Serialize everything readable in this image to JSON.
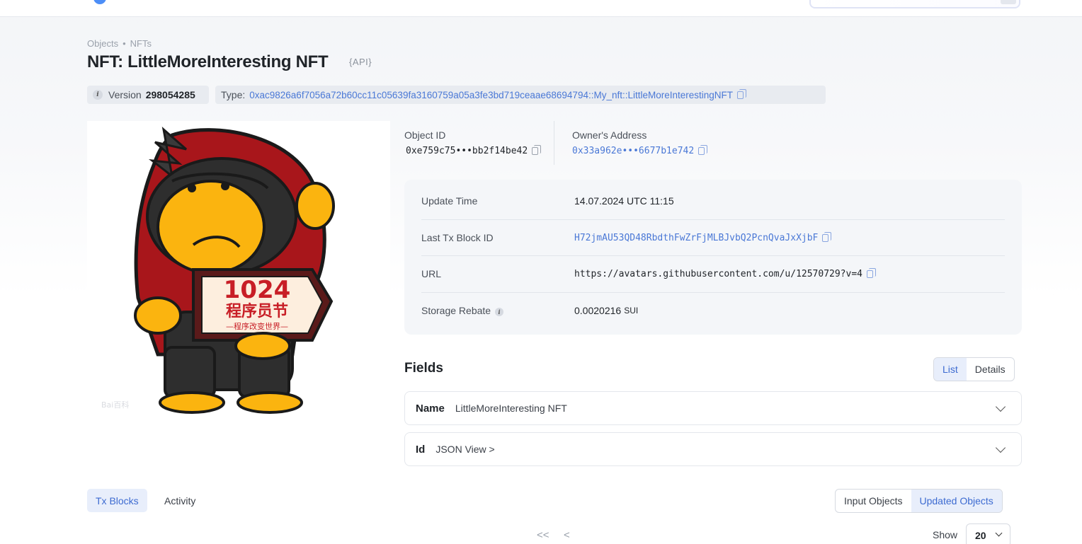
{
  "breadcrumb": {
    "items": [
      "Objects",
      "NFTs"
    ],
    "separator": "•"
  },
  "title": "NFT: LittleMoreInteresting NFT",
  "api_label": "{API}",
  "version": {
    "label": "Version",
    "value": "298054285"
  },
  "type": {
    "label": "Type:",
    "value": "0xac9826a6f7056a72b60cc11c05639fa3160759a05a3fe3bd719ceaae68694794::My_nft::LittleMoreInterestingNFT"
  },
  "object_id": {
    "label": "Object ID",
    "value": "0xe759c75•••bb2f14be42"
  },
  "owner": {
    "label": "Owner's Address",
    "value": "0x33a962e•••6677b1e742"
  },
  "properties": [
    {
      "label": "Update Time",
      "value": "14.07.2024 UTC 11:15"
    },
    {
      "label": "Last Tx Block ID",
      "value": "H72jmAU53QD48RbdthFwZrFjMLBJvbQ2PcnQvaJxXjbF"
    },
    {
      "label": "URL",
      "value": "https://avatars.githubusercontent.com/u/12570729?v=4"
    },
    {
      "label": "Storage Rebate",
      "value": "0.0020216",
      "unit": "SUI"
    }
  ],
  "nft_image": {
    "sign_text_1": "1024",
    "sign_text_2": "程序员节",
    "sign_text_3": "—程序改变世界—",
    "watermark": "Bai百科"
  },
  "fields": {
    "title": "Fields",
    "view_options": [
      "List",
      "Details"
    ],
    "active_view": "List",
    "rows": [
      {
        "name": "Name",
        "value": "LittleMoreInteresting NFT"
      },
      {
        "name": "Id",
        "value": "JSON View >"
      }
    ]
  },
  "tabs": [
    "Tx Blocks",
    "Activity"
  ],
  "object_filter": [
    "Input Objects",
    "Updated Objects"
  ],
  "pagination": {
    "first": "<<",
    "prev": "<",
    "show_label": "Show",
    "page_size": "20"
  },
  "colors": {
    "accent": "#3d6bd1",
    "link": "#4a78d6",
    "hood": "#a8161b",
    "face": "#fbb40f",
    "sign": "#c81e26"
  }
}
